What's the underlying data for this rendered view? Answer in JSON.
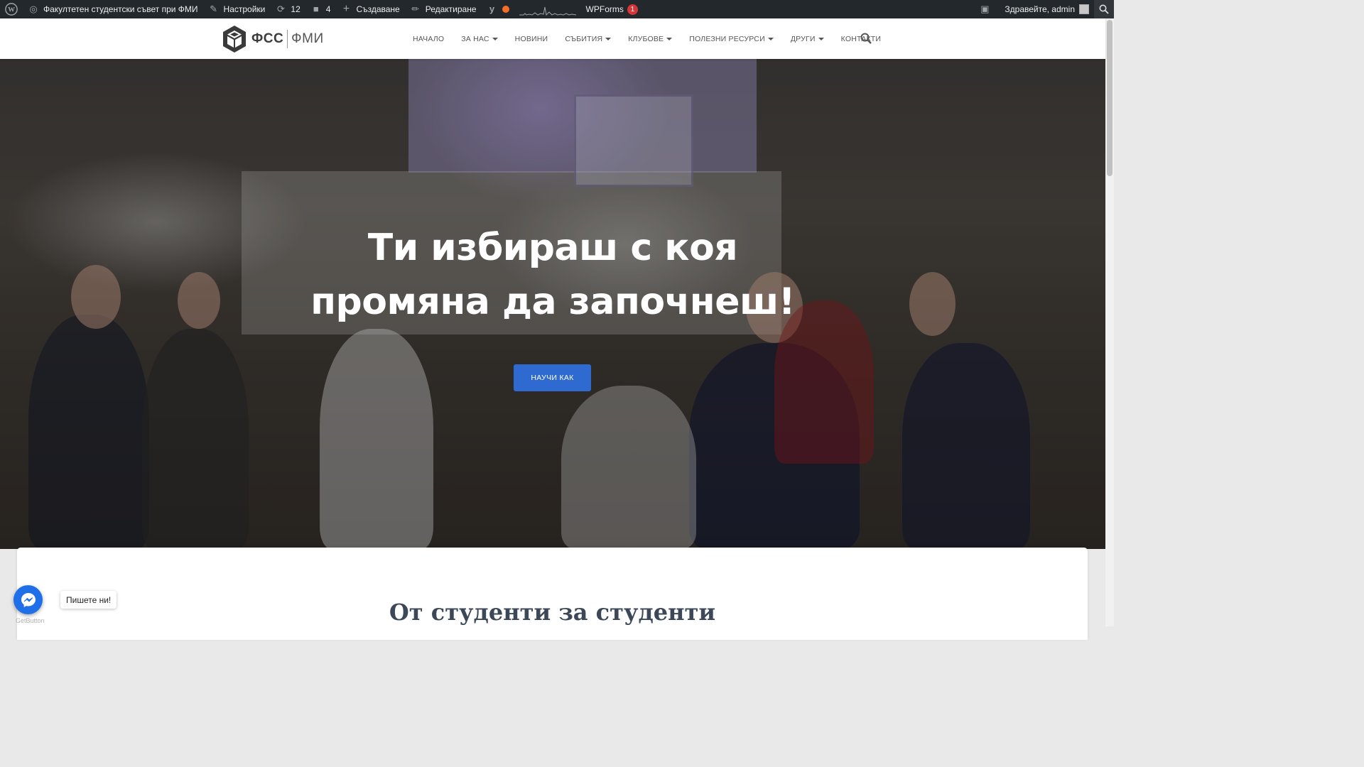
{
  "admin_bar": {
    "site_name": "Факултетен студентски съвет при ФМИ",
    "customize": "Настройки",
    "updates_count": "12",
    "comments_count": "4",
    "new": "Създаване",
    "edit": "Редактиране",
    "wpforms": "WPForms",
    "wpforms_badge": "1",
    "greeting": "Здравейте, admin"
  },
  "header": {
    "logo_primary": "ФСС",
    "logo_secondary": "ФМИ",
    "nav": [
      {
        "label": "НАЧАЛО",
        "dropdown": false
      },
      {
        "label": "ЗА НАС",
        "dropdown": true
      },
      {
        "label": "НОВИНИ",
        "dropdown": false
      },
      {
        "label": "СЪБИТИЯ",
        "dropdown": true
      },
      {
        "label": "КЛУБОВЕ",
        "dropdown": true
      },
      {
        "label": "ПОЛЕЗНИ РЕСУРСИ",
        "dropdown": true
      },
      {
        "label": "ДРУГИ",
        "dropdown": true
      },
      {
        "label": "КОНТАКТИ",
        "dropdown": false
      }
    ]
  },
  "hero": {
    "title_line1": "Ти избираш с коя",
    "title_line2": "промяна да започнеш!",
    "button_label": "НАУЧИ КАК"
  },
  "section": {
    "title": "От студенти за студенти"
  },
  "messenger": {
    "tooltip": "Пишете ни!",
    "brand": "GetButton"
  },
  "colors": {
    "admin_bar_bg": "#23282d",
    "accent": "#2e6ad0",
    "messenger": "#1f6fe8",
    "badge": "#d63638"
  }
}
